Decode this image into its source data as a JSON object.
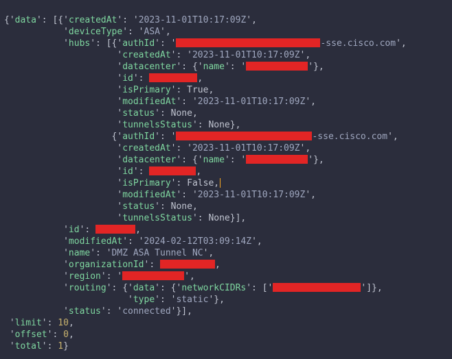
{
  "response": {
    "data": [
      {
        "createdAt": "2023-11-01T10:17:09Z",
        "deviceType": "ASA",
        "hubs": [
          {
            "authId_prefix_redacted": true,
            "authId_suffix": "-sse.cisco.com",
            "createdAt": "2023-11-01T10:17:09Z",
            "datacenter": {
              "name_redacted": true
            },
            "id_redacted": true,
            "isPrimary": "True",
            "modifiedAt": "2023-11-01T10:17:09Z",
            "status": "None",
            "tunnelsStatus": "None"
          },
          {
            "authId_prefix_redacted": true,
            "authId_suffix": "-sse.cisco.com",
            "createdAt": "2023-11-01T10:17:09Z",
            "datacenter": {
              "name_redacted": true
            },
            "id_redacted": true,
            "isPrimary": "False",
            "modifiedAt": "2023-11-01T10:17:09Z",
            "status": "None",
            "tunnelsStatus": "None"
          }
        ],
        "id_redacted": true,
        "modifiedAt": "2024-02-12T03:09:14Z",
        "name": "DMZ ASA Tunnel NC",
        "organizationId_redacted": true,
        "region_redacted": true,
        "routing": {
          "data": {
            "networkCIDRs_redacted": true,
            "type": "static"
          }
        },
        "status": "connected"
      }
    ],
    "limit": 10,
    "offset": 0,
    "total": 1
  },
  "labels": {
    "data": "data",
    "createdAt": "createdAt",
    "deviceType": "deviceType",
    "hubs": "hubs",
    "authId": "authId",
    "datacenter": "datacenter",
    "name": "name",
    "id": "id",
    "isPrimary": "isPrimary",
    "modifiedAt": "modifiedAt",
    "status": "status",
    "tunnelsStatus": "tunnelsStatus",
    "organizationId": "organizationId",
    "region": "region",
    "routing": "routing",
    "networkCIDRs": "networkCIDRs",
    "type": "type",
    "limit": "limit",
    "offset": "offset",
    "total": "total"
  }
}
